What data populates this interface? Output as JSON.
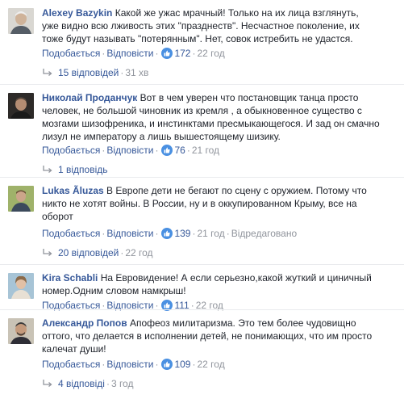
{
  "labels": {
    "like": "Подобається",
    "reply": "Відповісти",
    "dot": "·"
  },
  "colors": {
    "link": "#365899",
    "meta": "#90949c",
    "like_badge": "#4a90e2"
  },
  "comments": [
    {
      "author": "Alexey Bazykin",
      "text": "Какой же ужас мрачный! Только на их лица взглянуть, уже видно всю лживость этих \"празднеств\". Несчастное поколение, их тоже будут называть \"потерянным\". Нет, совок истребить не удастся.",
      "likes": "172",
      "time": "22 год",
      "edited": "",
      "replies_label": "15 відповідей",
      "replies_time": "31 хв"
    },
    {
      "author": "Николай Проданчук",
      "text": "Вот в чем уверен что постановщик танца просто человек, не большой чиновник из кремля , а обыкновенное существо с мозгами шизофреника, и инстинктами пресмыкающегося. И зад он смачно лизул не императору а лишь вышестоящему шизику.",
      "likes": "76",
      "time": "21 год",
      "edited": "",
      "replies_label": "1 відповідь",
      "replies_time": ""
    },
    {
      "author": "Lukas Ãluzas",
      "text": "В Европе дети не бегают по сцену с оружием. Потому что никто не хотят войны. В России, ну и в оккупированном Крыму, все на оборот",
      "likes": "139",
      "time": "21 год",
      "edited": "Відредаговано",
      "replies_label": "20 відповідей",
      "replies_time": "22 год"
    },
    {
      "author": "Kira Schabli",
      "text": "На Евровидение! А если серьезно,какой жуткий и циничный номер.Одним словом намкрыш!",
      "likes": "111",
      "time": "22 год",
      "edited": "",
      "replies_label": "",
      "replies_time": ""
    },
    {
      "author": "Александр Попов",
      "text": "Апофеоз милитаризма. Это тем более чудовищно оттого, что делается в исполнении детей, не понимающих, что им просто калечат души!",
      "likes": "109",
      "time": "22 год",
      "edited": "",
      "replies_label": "4 відповіді",
      "replies_time": "3 год"
    }
  ]
}
